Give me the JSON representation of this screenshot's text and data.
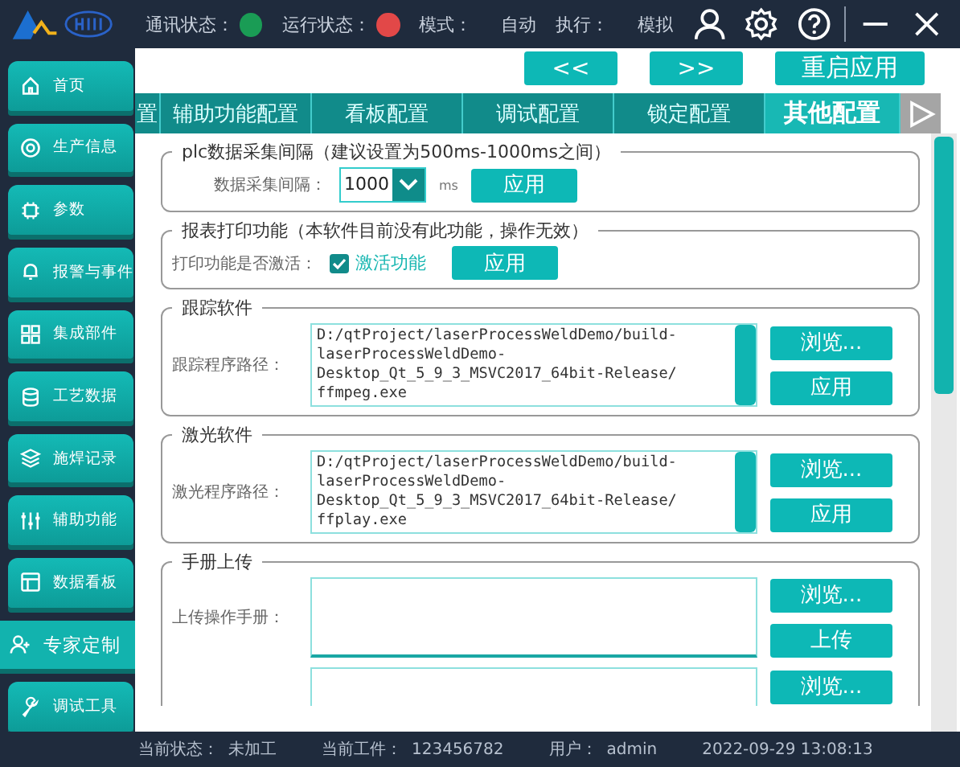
{
  "header": {
    "statuses": [
      {
        "label": "通讯状态：",
        "color": "#1a9c55"
      },
      {
        "label": "运行状态：",
        "color": "#e24848"
      }
    ],
    "fields": [
      {
        "label": "模式：",
        "value": "自动"
      },
      {
        "label": "执行：",
        "value": "模拟"
      }
    ]
  },
  "sidebar": {
    "items": [
      {
        "label": "首页",
        "selected": false
      },
      {
        "label": "生产信息",
        "selected": false
      },
      {
        "label": "参数",
        "selected": false
      },
      {
        "label": "报警与事件",
        "selected": false
      },
      {
        "label": "集成部件",
        "selected": false
      },
      {
        "label": "工艺数据",
        "selected": false
      },
      {
        "label": "施焊记录",
        "selected": false
      },
      {
        "label": "辅助功能",
        "selected": false
      },
      {
        "label": "数据看板",
        "selected": false
      },
      {
        "label": "专家定制",
        "selected": true
      },
      {
        "label": "调试工具",
        "selected": false
      }
    ]
  },
  "nav_buttons": [
    "<<",
    ">>",
    "重启应用"
  ],
  "tabs": [
    {
      "label": "置",
      "selected": false
    },
    {
      "label": "辅助功能配置",
      "selected": false
    },
    {
      "label": "看板配置",
      "selected": false
    },
    {
      "label": "调试配置",
      "selected": false
    },
    {
      "label": "锁定配置",
      "selected": false
    },
    {
      "label": "其他配置",
      "selected": true
    }
  ],
  "groups": [
    {
      "kind": "interval",
      "title": "plc数据采集间隔（建议设置为500ms-1000ms之间）",
      "label": "数据采集间隔：",
      "value": "1000",
      "unit": "ms",
      "button": "应用"
    },
    {
      "kind": "print",
      "title": "报表打印功能（本软件目前没有此功能，操作无效）",
      "label": "打印功能是否激活：",
      "checkbox": {
        "label": "激活功能",
        "checked": true
      },
      "button": "应用"
    },
    {
      "kind": "path",
      "title": "跟踪软件",
      "label": "跟踪程序路径：",
      "lines": [
        "D:/qtProject/laserProcessWeldDemo/build-",
        "laserProcessWeldDemo-",
        "Desktop_Qt_5_9_3_MSVC2017_64bit-Release/",
        "ffmpeg.exe"
      ],
      "buttons": [
        "浏览...",
        "应用"
      ]
    },
    {
      "kind": "path",
      "title": "激光软件",
      "label": "激光程序路径：",
      "lines": [
        "D:/qtProject/laserProcessWeldDemo/build-",
        "laserProcessWeldDemo-",
        "Desktop_Qt_5_9_3_MSVC2017_64bit-Release/",
        "ffplay.exe"
      ],
      "buttons": [
        "浏览...",
        "应用"
      ]
    },
    {
      "kind": "upload",
      "title": "手册上传",
      "label": "上传操作手册：",
      "buttons": [
        "浏览...",
        "上传"
      ],
      "extra_button": "浏览..."
    }
  ],
  "status_bar": [
    {
      "label": "当前状态：",
      "value": "未加工"
    },
    {
      "label": "当前工件：",
      "value": "123456782"
    },
    {
      "label": "用户：",
      "value": "admin"
    },
    {
      "value": "2022-09-29 13:08:13"
    }
  ]
}
